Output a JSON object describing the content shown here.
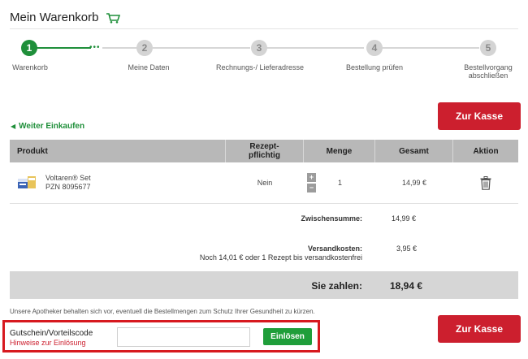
{
  "header": {
    "title": "Mein Warenkorb",
    "cart_icon": "cart-icon"
  },
  "stepper": {
    "steps": [
      {
        "number": "1",
        "label": "Warenkorb",
        "active": true
      },
      {
        "number": "2",
        "label": "Meine Daten",
        "active": false
      },
      {
        "number": "3",
        "label": "Rechnungs-/ Lieferadresse",
        "active": false
      },
      {
        "number": "4",
        "label": "Bestellung prüfen",
        "active": false
      },
      {
        "number": "5",
        "label_line1": "Bestellvorgang",
        "label_line2": "abschließen",
        "active": false
      }
    ]
  },
  "actions": {
    "checkout_label": "Zur Kasse",
    "back_label": "Weiter Einkaufen"
  },
  "table": {
    "headers": {
      "product": "Produkt",
      "prescription_line1": "Rezept-",
      "prescription_line2": "pflichtig",
      "quantity": "Menge",
      "total": "Gesamt",
      "action": "Aktion"
    },
    "rows": [
      {
        "name": "Voltaren® Set",
        "pzn": "PZN 8095677",
        "prescription": "Nein",
        "quantity": "1",
        "total": "14,99 €",
        "plus": "+",
        "minus": "−"
      }
    ]
  },
  "totals": {
    "subtotal_label": "Zwischensumme:",
    "subtotal_value": "14,99 €",
    "shipping_label": "Versandkosten:",
    "shipping_value": "3,95 €",
    "shipping_hint": "Noch 14,01 € oder 1 Rezept bis versandkostenfrei",
    "pay_label": "Sie zahlen:",
    "pay_value": "18,94 €"
  },
  "note": "Unsere Apotheker behalten sich vor, eventuell die Bestellmengen zum Schutz Ihrer Gesundheit zu kürzen.",
  "coupon": {
    "title": "Gutschein/Vorteilscode",
    "hint": "Hinweise zur Einlösung",
    "input_value": "",
    "input_placeholder": "",
    "button_label": "Einlösen"
  },
  "colors": {
    "accent_green": "#1f8f3a",
    "accent_red": "#cc1f2e",
    "highlight_border": "#d7191f"
  }
}
